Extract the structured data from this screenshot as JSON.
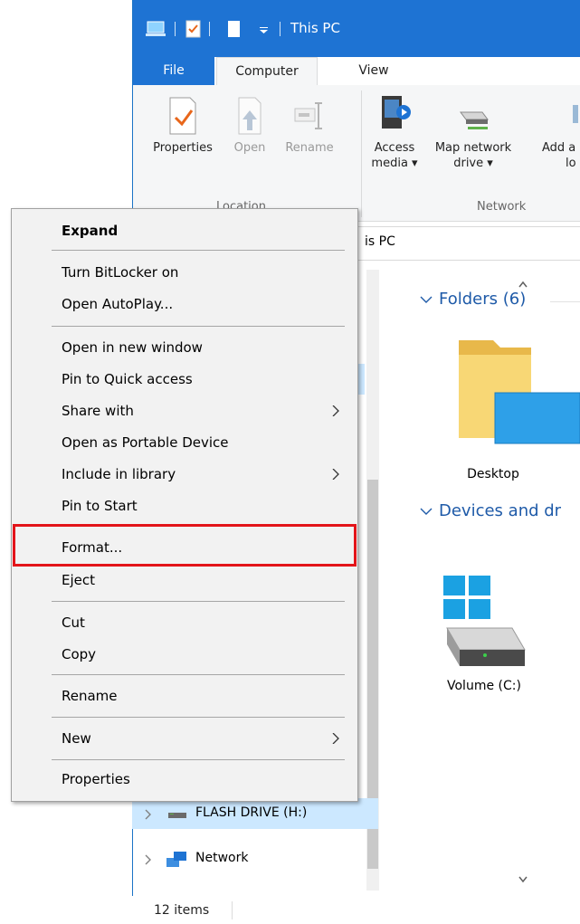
{
  "window": {
    "title": "This PC",
    "tabs": {
      "file": "File",
      "computer": "Computer",
      "view": "View"
    }
  },
  "ribbon": {
    "properties": "Properties",
    "open": "Open",
    "rename": "Rename",
    "access_media_1": "Access",
    "access_media_2": "media ▾",
    "map_drive_1": "Map network",
    "map_drive_2": "drive ▾",
    "add_loc_1": "Add a",
    "add_loc_2": "lo",
    "group_location": "Location",
    "group_network": "Network"
  },
  "address": {
    "path": "is PC"
  },
  "content": {
    "folders_header": "Folders (6)",
    "desktop_label": "Desktop",
    "devices_header": "Devices and dr",
    "volume_label": "Volume (C:)"
  },
  "nav": {
    "flash_drive": "FLASH DRIVE (H:)",
    "network": "Network"
  },
  "status": {
    "items": "12 items"
  },
  "context_menu": {
    "expand": "Expand",
    "bitlocker": "Turn BitLocker on",
    "autoplay": "Open AutoPlay...",
    "new_window": "Open in new window",
    "pin_quick": "Pin to Quick access",
    "share_with": "Share with",
    "portable": "Open as Portable Device",
    "include_library": "Include in library",
    "pin_start": "Pin to Start",
    "format": "Format...",
    "eject": "Eject",
    "cut": "Cut",
    "copy": "Copy",
    "rename": "Rename",
    "new": "New",
    "properties": "Properties"
  },
  "colors": {
    "accent": "#1e73d3",
    "highlight": "#e3141a",
    "link": "#1e5aa8"
  }
}
